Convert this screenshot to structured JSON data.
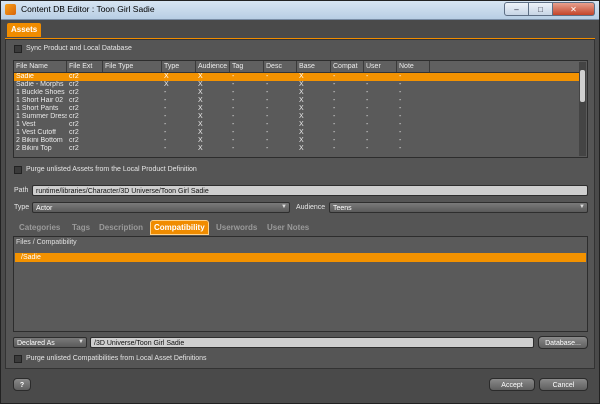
{
  "window": {
    "title": "Content DB Editor : Toon Girl Sadie",
    "minimize_glyph": "–",
    "maximize_glyph": "□",
    "close_glyph": "✕"
  },
  "assets_tab": "Assets",
  "sync_label": "Sync Product and Local Database",
  "table": {
    "headers": [
      "File Name",
      "File Ext",
      "File Type",
      "Type",
      "Audience",
      "Tag",
      "Desc",
      "Base",
      "Compat",
      "User",
      "Note"
    ],
    "rows": [
      [
        "Sadie",
        "cr2",
        "",
        "X",
        "X",
        "-",
        "-",
        "X",
        "-",
        "-",
        "-"
      ],
      [
        "Sadie - Morphs",
        "cr2",
        "",
        "X",
        "X",
        "-",
        "-",
        "X",
        "-",
        "-",
        "-"
      ],
      [
        "1 Buckle Shoes",
        "cr2",
        "",
        "-",
        "X",
        "-",
        "-",
        "X",
        "-",
        "-",
        "-"
      ],
      [
        "1 Short Hair 02",
        "cr2",
        "",
        "-",
        "X",
        "-",
        "-",
        "X",
        "-",
        "-",
        "-"
      ],
      [
        "1 Short Pants",
        "cr2",
        "",
        "-",
        "X",
        "-",
        "-",
        "X",
        "-",
        "-",
        "-"
      ],
      [
        "1 Summer Dress",
        "cr2",
        "",
        "-",
        "X",
        "-",
        "-",
        "X",
        "-",
        "-",
        "-"
      ],
      [
        "1 Vest",
        "cr2",
        "",
        "-",
        "X",
        "-",
        "-",
        "X",
        "-",
        "-",
        "-"
      ],
      [
        "1 Vest Cutoff",
        "cr2",
        "",
        "-",
        "X",
        "-",
        "-",
        "X",
        "-",
        "-",
        "-"
      ],
      [
        "2 Bikini Bottom",
        "cr2",
        "",
        "-",
        "X",
        "-",
        "-",
        "X",
        "-",
        "-",
        "-"
      ],
      [
        "2 Bikini Top",
        "cr2",
        "",
        "-",
        "X",
        "-",
        "-",
        "X",
        "-",
        "-",
        "-"
      ]
    ]
  },
  "purge_assets_label": "Purge unlisted Assets from the Local Product Definition",
  "path": {
    "label": "Path",
    "value": "runtime/libraries/Character/3D Universe/Toon Girl Sadie"
  },
  "type": {
    "label": "Type",
    "value": "Actor"
  },
  "audience": {
    "label": "Audience",
    "value": "Teens"
  },
  "subtabs": [
    "Categories",
    "Tags",
    "Description",
    "Compatibility",
    "Userwords",
    "User Notes"
  ],
  "compat": {
    "header": "Files / Compatibility",
    "selected_row": "/Sadie"
  },
  "declared": {
    "select_value": "Declared As",
    "path_value": "/3D Universe/Toon Girl Sadie",
    "database_button": "Database..."
  },
  "purge_compat_label": "Purge unlisted Compatibilities from Local Asset Definitions",
  "buttons": {
    "help": "?",
    "accept": "Accept",
    "cancel": "Cancel"
  },
  "colors": {
    "accent": "#f08c00",
    "selection": "#f39200"
  }
}
